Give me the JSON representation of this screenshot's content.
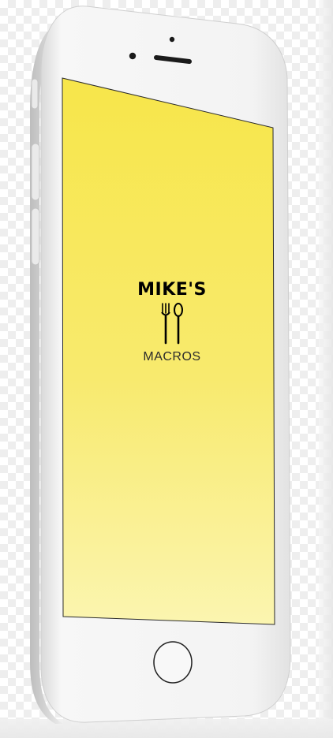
{
  "app": {
    "logo_title": "MIKE'S",
    "logo_subtitle": "MACROS",
    "logo_icon": "fork-and-spoon-icon"
  },
  "device": {
    "model_icon": "smartphone-frame",
    "frame_color": "#f4f4f4",
    "screen_gradient_top": "#f7e64a",
    "screen_gradient_bottom": "#fbf5b0"
  }
}
